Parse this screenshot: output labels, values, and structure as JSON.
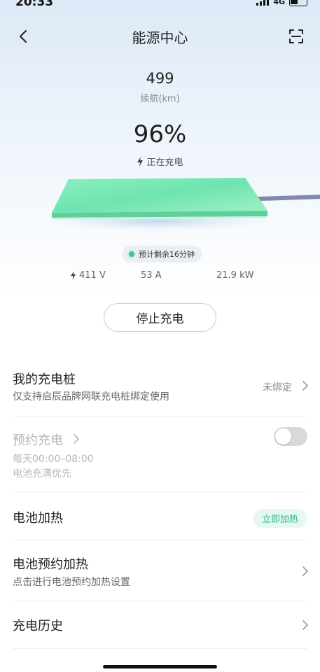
{
  "status_bar": {
    "time": "20:33",
    "network": "4G"
  },
  "header": {
    "title": "能源中心"
  },
  "range": {
    "value": "499",
    "label": "续航(km)"
  },
  "battery": {
    "percent": "96%",
    "status": "正在充电",
    "fill_level": 0.96
  },
  "eta": {
    "text": "预计剩余16分钟"
  },
  "metrics": {
    "voltage": "411 V",
    "current": "53 A",
    "power": "21.9 kW"
  },
  "actions": {
    "stop_label": "停止充电"
  },
  "my_charger": {
    "title": "我的充电桩",
    "subtitle": "仅支持启辰品牌网联充电桩绑定使用",
    "status": "未绑定"
  },
  "scheduled_charging": {
    "title": "预约充电",
    "time": "每天00:00–08:00",
    "mode": "电池充满优先",
    "enabled": false
  },
  "battery_heating": {
    "title": "电池加热",
    "button": "立即加热"
  },
  "scheduled_heating": {
    "title": "电池预约加热",
    "subtitle": "点击进行电池预约加热设置"
  },
  "history": {
    "title": "充电历史"
  },
  "colors": {
    "accent": "#2bb48a",
    "pad_green": "#7de6b4",
    "cable": "#7e8aa8"
  }
}
